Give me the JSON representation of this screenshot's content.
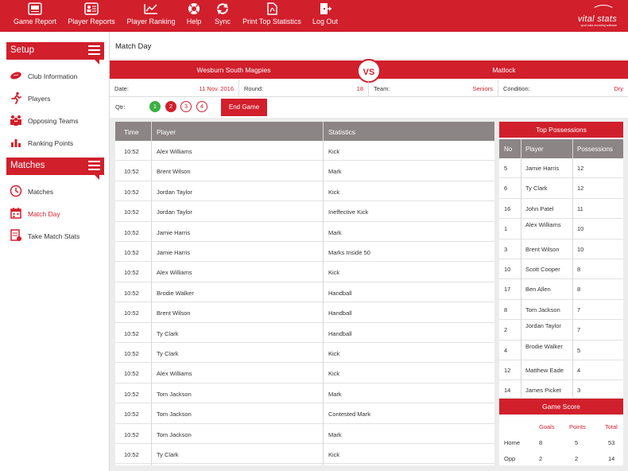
{
  "nav": [
    {
      "label": "Game Report",
      "icon": "game-report-icon"
    },
    {
      "label": "Player Reports",
      "icon": "player-reports-icon"
    },
    {
      "label": "Player Ranking",
      "icon": "player-ranking-icon"
    },
    {
      "label": "Help",
      "icon": "help-icon"
    },
    {
      "label": "Sync",
      "icon": "sync-icon"
    },
    {
      "label": "Print Top Statistics",
      "icon": "pdf-icon"
    },
    {
      "label": "Log Out",
      "icon": "logout-icon"
    }
  ],
  "logo": {
    "name": "vital stats",
    "tagline": "sport data recording software"
  },
  "sidebar": {
    "setup_title": "Setup",
    "setup_items": [
      {
        "label": "Club Information",
        "icon": "football-icon"
      },
      {
        "label": "Players",
        "icon": "runner-icon"
      },
      {
        "label": "Opposing Teams",
        "icon": "team-icon"
      },
      {
        "label": "Ranking Points",
        "icon": "bar-chart-icon"
      }
    ],
    "matches_title": "Matches",
    "matches_items": [
      {
        "label": "Matches",
        "icon": "clock-icon"
      },
      {
        "label": "Match Day",
        "icon": "calendar-icon",
        "active": true
      },
      {
        "label": "Take Match Stats",
        "icon": "stats-sheet-icon"
      }
    ]
  },
  "page": {
    "title": "Match Day"
  },
  "match": {
    "home_team": "Wesburn South Magpies",
    "vs": "VS",
    "away_team": "Matlock",
    "date_label": "Date:",
    "date": "11 Nov. 2016",
    "round_label": "Round:",
    "round": "18",
    "team_label": "Team:",
    "team": "Seniors",
    "condition_label": "Condition:",
    "condition": "Dry",
    "qtr_label": "Qtr:",
    "quarters": [
      "1",
      "2",
      "3",
      "4"
    ],
    "completed_quarters": 1,
    "current_quarter": 2,
    "end_game_label": "End Game"
  },
  "events": {
    "columns": [
      "Time",
      "Player",
      "Statistics"
    ],
    "rows": [
      [
        "10:52",
        "Alex Williams",
        "Kick"
      ],
      [
        "10:52",
        "Brent Wilson",
        "Mark"
      ],
      [
        "10:52",
        "Jordan Taylor",
        "Kick"
      ],
      [
        "10:52",
        "Jordan Taylor",
        "Ineffective Kick"
      ],
      [
        "10:52",
        "Jamie Harris",
        "Mark"
      ],
      [
        "10:52",
        "Jamie Harris",
        "Marks Inside 50"
      ],
      [
        "10:52",
        "Alex Williams",
        "Kick"
      ],
      [
        "10:52",
        "Brodie Walker",
        "Handball"
      ],
      [
        "10:52",
        "Brent Wilson",
        "Handball"
      ],
      [
        "10:52",
        "Ty Clark",
        "Handball"
      ],
      [
        "10:52",
        "Ty Clark",
        "Kick"
      ],
      [
        "10:52",
        "Alex Williams",
        "Kick"
      ],
      [
        "10:52",
        "Tom Jackson",
        "Mark"
      ],
      [
        "10:52",
        "Tom Jackson",
        "Contested Mark"
      ],
      [
        "10:52",
        "Tom Jackson",
        "Mark"
      ],
      [
        "10:52",
        "Ty Clark",
        "Kick"
      ]
    ]
  },
  "possessions": {
    "title": "Top Possessions",
    "columns": [
      "No",
      "Player",
      "Possessions"
    ],
    "rows": [
      [
        "5",
        "Jamie Harris",
        "12"
      ],
      [
        "6",
        "Ty Clark",
        "12"
      ],
      [
        "16",
        "John Patel",
        "11"
      ],
      [
        "1",
        "Alex Williams",
        "10"
      ],
      [
        "3",
        "Brent Wilson",
        "10"
      ],
      [
        "10",
        "Scott Cooper",
        "8"
      ],
      [
        "17",
        "Ben Allen",
        "8"
      ],
      [
        "8",
        "Tom Jackson",
        "7"
      ],
      [
        "2",
        "Jordan Taylor",
        "7"
      ],
      [
        "4",
        "Brodie Walker",
        "5"
      ],
      [
        "12",
        "Matthew Eade",
        "4"
      ],
      [
        "14",
        "James Picket",
        "3"
      ]
    ]
  },
  "game_score": {
    "title": "Game Score",
    "columns": [
      "Goals",
      "Points",
      "Total"
    ],
    "rows": [
      {
        "label": "Home",
        "goals": "8",
        "points": "5",
        "total": "53"
      },
      {
        "label": "Opp",
        "goals": "2",
        "points": "2",
        "total": "14"
      }
    ]
  },
  "colors": {
    "brand": "#d11f2c",
    "header_gray": "#8c8585",
    "done_green": "#3cb043"
  }
}
